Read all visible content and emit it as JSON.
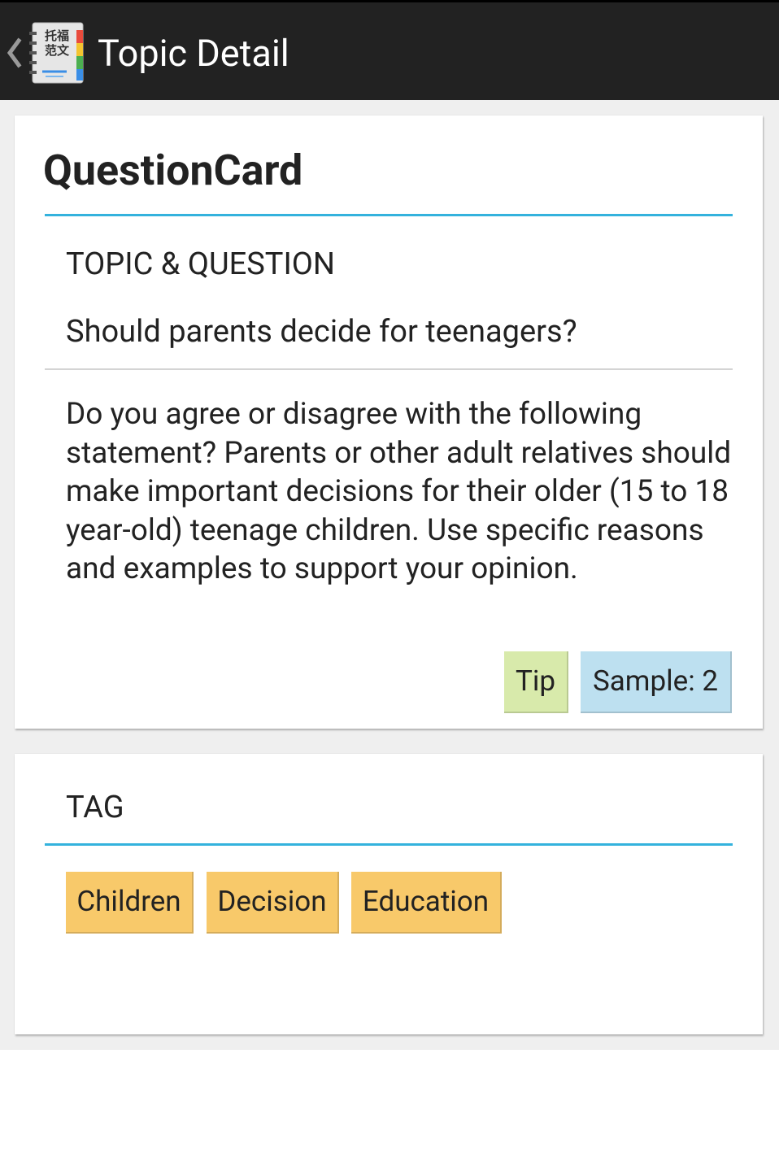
{
  "action_bar": {
    "title": "Topic Detail",
    "app_icon_text_line1": "托福",
    "app_icon_text_line2": "范文"
  },
  "question_card": {
    "heading": "QuestionCard",
    "section_label": "TOPIC & QUESTION",
    "question": "Should parents decide for teenagers?",
    "statement": "Do you agree or disagree with the following statement? Parents or other adult relatives should make important decisions for their older (15 to 18 year-old) teenage children. Use specific reasons and examples to support your opinion.",
    "tip_label": "Tip",
    "sample_label": "Sample: 2",
    "colors": {
      "tip_bg": "#d8eaab",
      "sample_bg": "#bde0f0",
      "divider_accent": "#34b2dd"
    }
  },
  "tag_card": {
    "section_label": "TAG",
    "tags": [
      "Children",
      "Decision",
      "Education"
    ],
    "tag_bg": "#f8c96a"
  }
}
